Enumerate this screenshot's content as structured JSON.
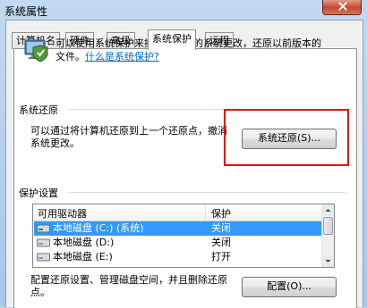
{
  "window": {
    "title": "系统属性"
  },
  "tabs": [
    {
      "label": "计算机名"
    },
    {
      "label": "硬件"
    },
    {
      "label": "高级"
    },
    {
      "label": "系统保护"
    },
    {
      "label": "远程"
    }
  ],
  "intro": {
    "text": "可以使用系统保护来撤消不需要的系统更改，还原以前版本的文件。",
    "link": "什么是系统保护?"
  },
  "restore": {
    "title": "系统还原",
    "description": "可以通过将计算机还原到上一个还原点，撤消系统更改。",
    "button": "系统还原(S)..."
  },
  "protection": {
    "title": "保护设置",
    "headers": {
      "drive": "可用驱动器",
      "protection": "保护"
    },
    "rows": [
      {
        "drive": "本地磁盘 (C:) (系统)",
        "protection": "关闭"
      },
      {
        "drive": "本地磁盘 (D:)",
        "protection": "关闭"
      },
      {
        "drive": "本地磁盘 (E:)",
        "protection": "打开"
      }
    ],
    "configure_text": "配置还原设置、管理磁盘空间，并且删除还原点。",
    "configure_button": "配置(O)..."
  },
  "colors": {
    "selection": "#3399ff",
    "link": "#0066cc",
    "highlight_box": "#e20d0d"
  },
  "icons": {
    "system_protection": "shield-computer-icon",
    "drive": "hard-drive-icon"
  }
}
